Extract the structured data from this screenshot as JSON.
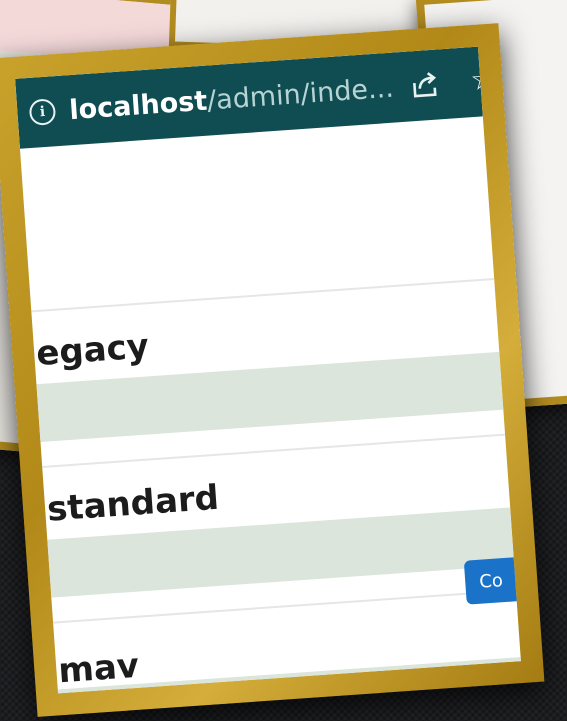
{
  "browser": {
    "url_host": "localhost",
    "url_path": "/admin/inde..."
  },
  "rows": [
    {
      "label": "egacy"
    },
    {
      "label": "standard"
    },
    {
      "label": "mav"
    }
  ],
  "action_button": {
    "label": "Co"
  },
  "colors": {
    "address_bar": "#0f4d52",
    "frame_gold": "#b28918",
    "row_band": "#dbe5dc",
    "button_blue": "#1a73c9"
  }
}
